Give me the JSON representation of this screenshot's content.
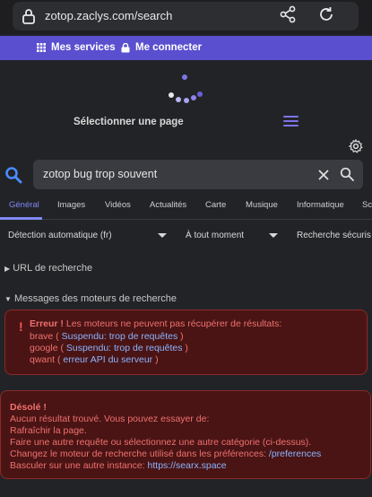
{
  "browser": {
    "url": "zotop.zaclys.com/search",
    "icons": [
      "lock-icon",
      "share-icon",
      "reload-icon"
    ]
  },
  "site_nav": {
    "services_label": "Mes services",
    "login_label": "Me connecter"
  },
  "category": {
    "title": "Sélectionner une page"
  },
  "search": {
    "query": "zotop bug trop souvent"
  },
  "tabs": [
    "Général",
    "Images",
    "Vidéos",
    "Actualités",
    "Carte",
    "Musique",
    "Informatique",
    "Sc"
  ],
  "active_tab": "Général",
  "filters": {
    "language": "Détection automatique (fr)",
    "time": "À tout moment",
    "safe": "Recherche sécuris"
  },
  "sections": {
    "url_label": "URL de recherche",
    "engines_label": "Messages des moteurs de recherche"
  },
  "engine_errors": {
    "heading": "Erreur !",
    "message": "Les moteurs ne peuvent pas récupérer de résultats:",
    "rows": [
      {
        "engine": "brave",
        "reason": "Suspendu: trop de requêtes"
      },
      {
        "engine": "google",
        "reason": "Suspendu: trop de requêtes"
      },
      {
        "engine": "qwant",
        "reason": "erreur API du serveur"
      }
    ]
  },
  "no_results": {
    "heading": "Désolé !",
    "line1": "Aucun résultat trouvé. Vous pouvez essayer de:",
    "line2": "Rafraîchir la page.",
    "line3": "Faire une autre requête ou sélectionnez une autre catégorie (ci-dessus).",
    "line4_prefix": "Changez le moteur de recherche utilisé dans les préférences: ",
    "line4_link": "/preferences",
    "line5_prefix": "Basculer sur une autre instance: ",
    "line5_link": "https://searx.space"
  },
  "colors": {
    "accent": "#5a4fcf",
    "tab_active": "#7f89f5",
    "error_bg": "#4a1414",
    "error_text": "#f07070"
  }
}
